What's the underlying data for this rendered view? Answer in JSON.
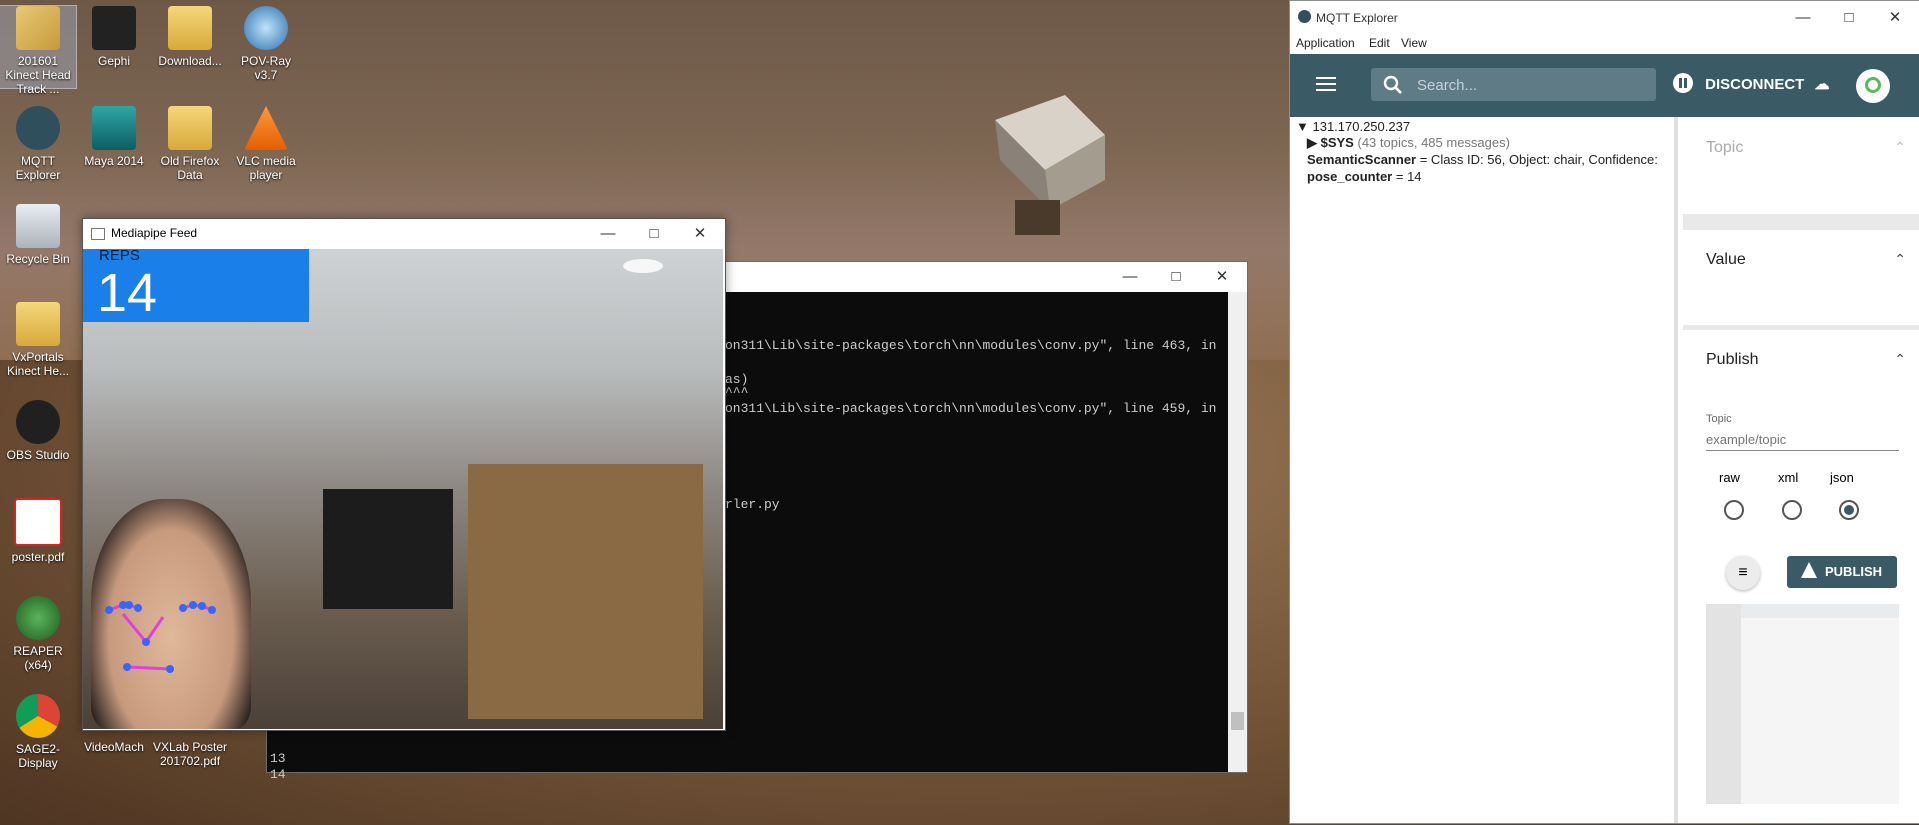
{
  "desktop": {
    "icons": [
      {
        "label": "201601 Kinect Head Track ...",
        "icon": "folder-image-icon"
      },
      {
        "label": "Gephi",
        "icon": "gephi-icon"
      },
      {
        "label": "Download...",
        "icon": "folder-icon"
      },
      {
        "label": "POV-Ray v3.7",
        "icon": "povray-icon"
      },
      {
        "label": "MQTT Explorer",
        "icon": "mqtt-explorer-icon"
      },
      {
        "label": "Maya 2014",
        "icon": "maya-icon"
      },
      {
        "label": "Old Firefox Data",
        "icon": "folder-icon"
      },
      {
        "label": "VLC media player",
        "icon": "vlc-icon"
      },
      {
        "label": "Recycle Bin",
        "icon": "recycle-bin-icon"
      },
      {
        "label": "VxPortals Kinect He...",
        "icon": "folder-icon"
      },
      {
        "label": "OBS Studio",
        "icon": "obs-icon"
      },
      {
        "label": "poster.pdf",
        "icon": "pdf-icon"
      },
      {
        "label": "REAPER (x64)",
        "icon": "reaper-icon"
      },
      {
        "label": "SAGE2-Display",
        "icon": "chrome-icon"
      },
      {
        "label": "VideoMach",
        "icon": "videomach-icon"
      },
      {
        "label": "VXLab Poster 201702.pdf",
        "icon": "pdf-icon"
      }
    ]
  },
  "console": {
    "lines": [
      "on311\\Lib\\site-packages\\torch\\nn\\modules\\conv.py\", line 463, in",
      "as)",
      "^^^",
      "on311\\Lib\\site-packages\\torch\\nn\\modules\\conv.py\", line 459, in",
      "rler.py",
      "13",
      "14"
    ]
  },
  "mediapipe": {
    "title": "Mediapipe Feed",
    "reps_label": "REPS",
    "reps_value": "14"
  },
  "mqtt": {
    "title": "MQTT Explorer",
    "menu": [
      "Application",
      "Edit",
      "View"
    ],
    "search_placeholder": "Search...",
    "disconnect_label": "DISCONNECT",
    "tree": {
      "host": "▼ 131.170.250.237",
      "sys_label": "▶ $SYS",
      "sys_meta": "(43 topics, 485 messages)",
      "row1_key": "SemanticScanner",
      "row1_val": " = Class ID: 56, Object: chair, Confidence:",
      "row2_key": "pose_counter",
      "row2_val": " = 14"
    },
    "panels": {
      "topic": "Topic",
      "value": "Value",
      "publish": "Publish",
      "publish_topic_label": "Topic",
      "publish_topic_placeholder": "example/topic",
      "formats": [
        "raw",
        "xml",
        "json"
      ],
      "selected_format": "json",
      "publish_button": "PUBLISH"
    },
    "colors": {
      "appbar": "#3a5a66",
      "accent": "#3a5a66"
    }
  }
}
